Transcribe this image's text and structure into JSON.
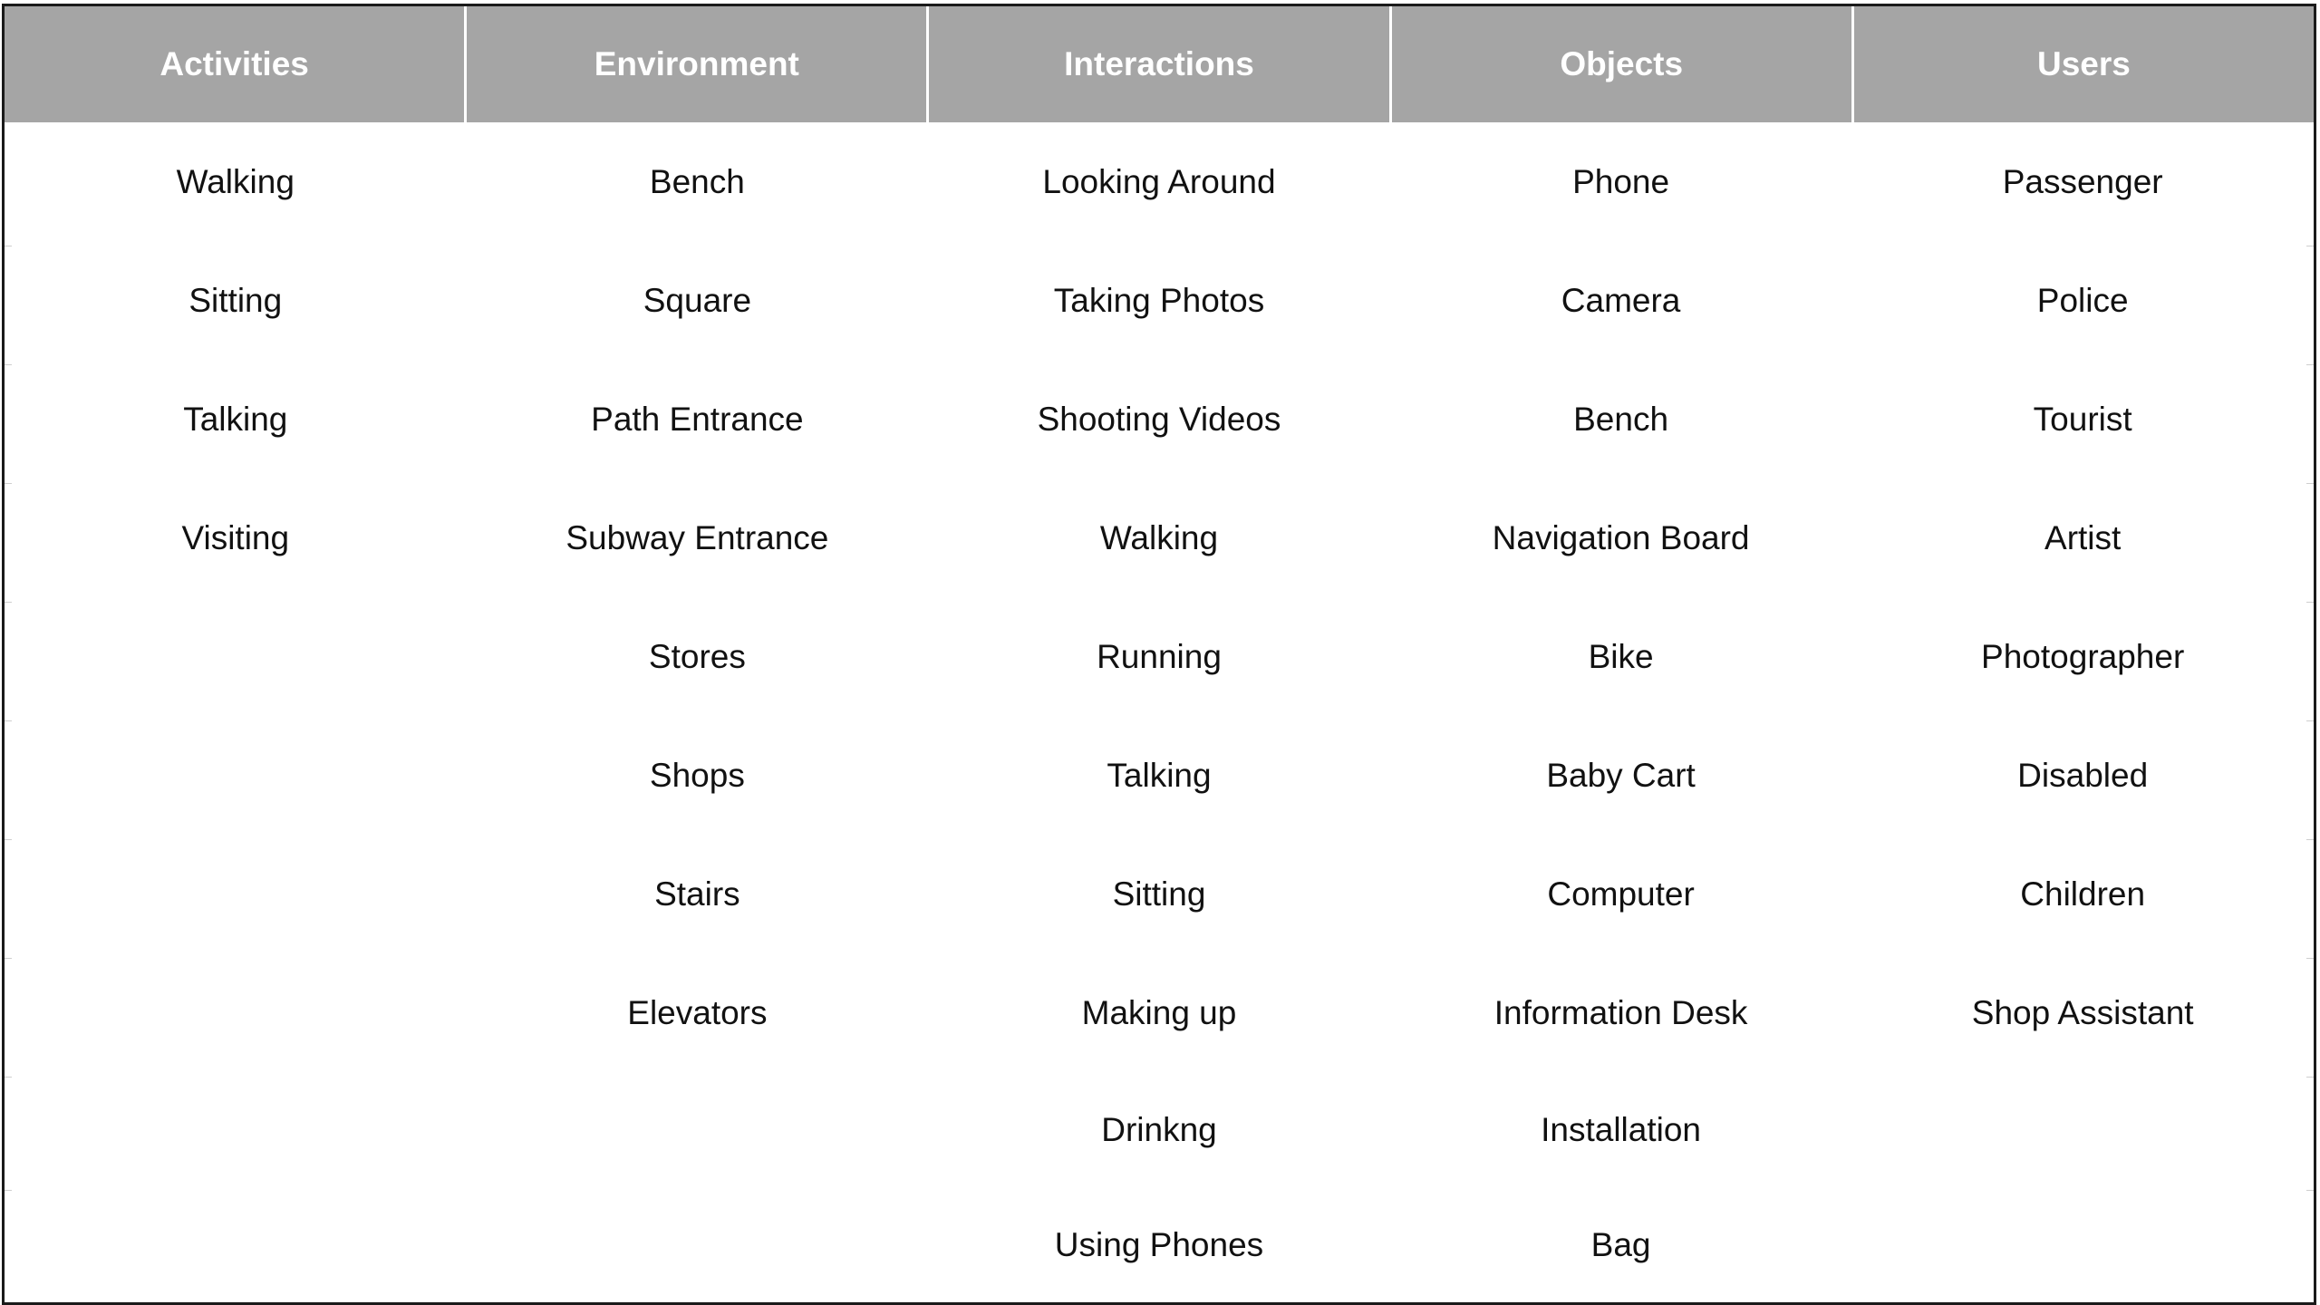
{
  "table": {
    "headers": [
      "Activities",
      "Environment",
      "Interactions",
      "Objects",
      "Users"
    ],
    "columns": [
      [
        "Walking",
        "Sitting",
        "Talking",
        "Visiting"
      ],
      [
        "Bench",
        "Square",
        "Path Entrance",
        "Subway Entrance",
        "Stores",
        "Shops",
        "Stairs",
        "Elevators"
      ],
      [
        "Looking Around",
        "Taking Photos",
        "Shooting Videos",
        "Walking",
        "Running",
        "Talking",
        "Sitting",
        "Making up",
        "Drinkng",
        "Using Phones"
      ],
      [
        "Phone",
        "Camera",
        "Bench",
        "Navigation Board",
        "Bike",
        "Baby Cart",
        "Computer",
        "Information Desk",
        "Installation",
        "Bag"
      ],
      [
        "Passenger",
        "Police",
        "Tourist",
        "Artist",
        "Photographer",
        "Disabled",
        "Children",
        "Shop Assistant"
      ]
    ]
  },
  "colors": {
    "header_bg": "#a5a5a5",
    "header_text": "#ffffff",
    "body_text": "#111111",
    "border": "#1a1a1a"
  }
}
